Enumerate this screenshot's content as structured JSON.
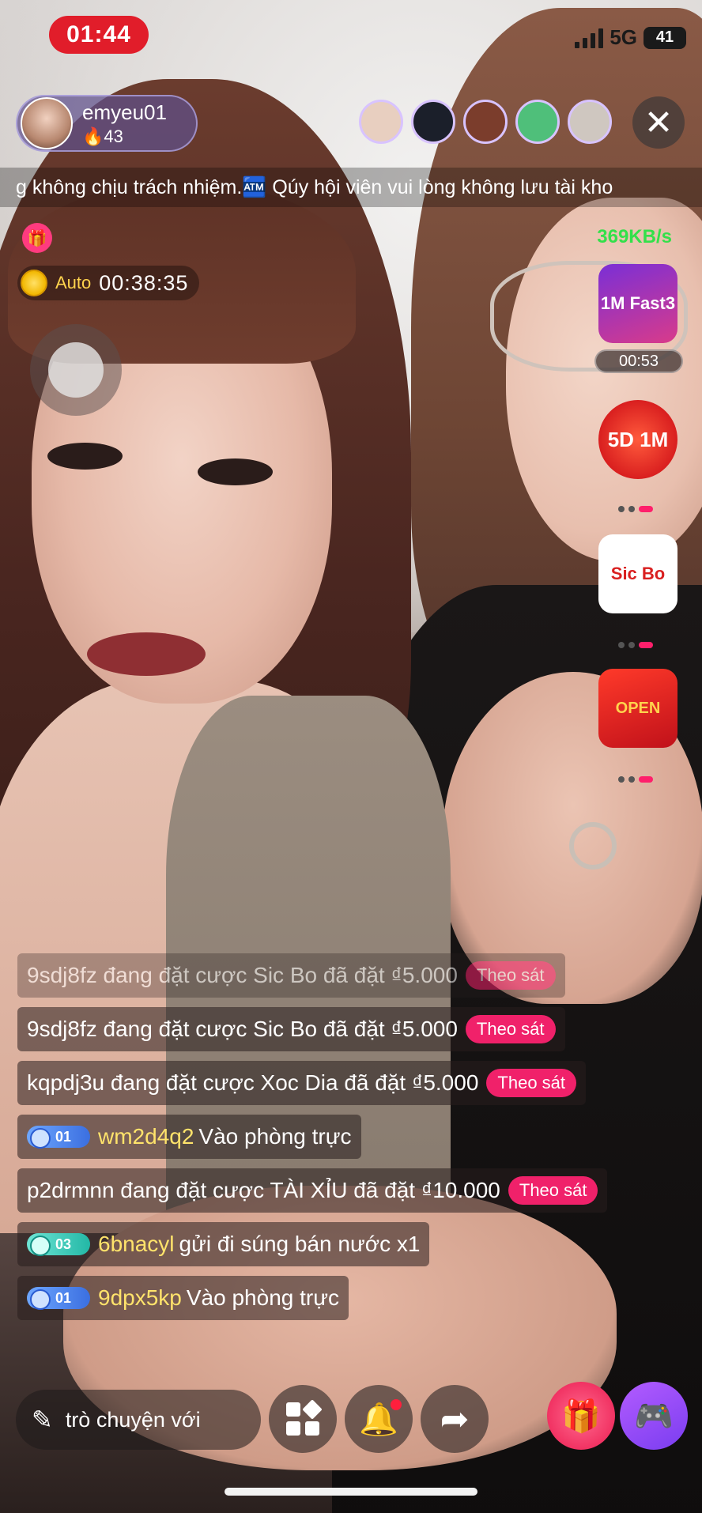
{
  "status_bar": {
    "time": "01:44",
    "network": "5G",
    "battery": "41"
  },
  "host": {
    "name": "emyeu01",
    "score": "🔥43"
  },
  "viewers": [
    "#e8cfc0",
    "#1b1f2a",
    "#7b3d2c",
    "#4fbf7a",
    "#cfc7c0"
  ],
  "close_glyph": "✕",
  "marquee": "g không chịu trách nhiệm.🏧 Qúy hội viên vui lòng không lưu tài kho",
  "auto": {
    "label": "Auto",
    "time": "00:38:35"
  },
  "network_speed": "369KB/s",
  "games": [
    {
      "name": "1M Fast3",
      "timer": "00:53"
    },
    {
      "name": "5D 1M"
    },
    {
      "name": "Sic Bo"
    },
    {
      "name": "Red envelope",
      "label": "OPEN"
    }
  ],
  "chat": [
    {
      "text": "9sdj8fz đang đặt cược Sic Bo đã đặt ₫5.000",
      "follow": "Theo sát",
      "faded": true
    },
    {
      "text": "9sdj8fz đang đặt cược Sic Bo đã đặt ₫5.000",
      "follow": "Theo sát"
    },
    {
      "text": "kqpdj3u đang đặt cược Xoc Dia đã đặt ₫5.000",
      "follow": "Theo sát"
    },
    {
      "level": "01",
      "user": "wm2d4q2",
      "text": "Vào phòng trực"
    },
    {
      "text": "p2drmnn đang đặt cược TÀI XỈU đã đặt ₫10.000",
      "follow": "Theo sát"
    },
    {
      "level": "03",
      "user": "6bnacyl",
      "text": "gửi đi súng bán nước x1"
    },
    {
      "level": "01",
      "user": "9dpx5kp",
      "text": "Vào phòng trực"
    }
  ],
  "bottom": {
    "input_placeholder": "trò chuyện với"
  },
  "colors": {
    "live_red": "#e11d2a",
    "follow_pink": "#f0216a",
    "speed_green": "#33e04a",
    "username_yellow": "#ffe36b"
  }
}
